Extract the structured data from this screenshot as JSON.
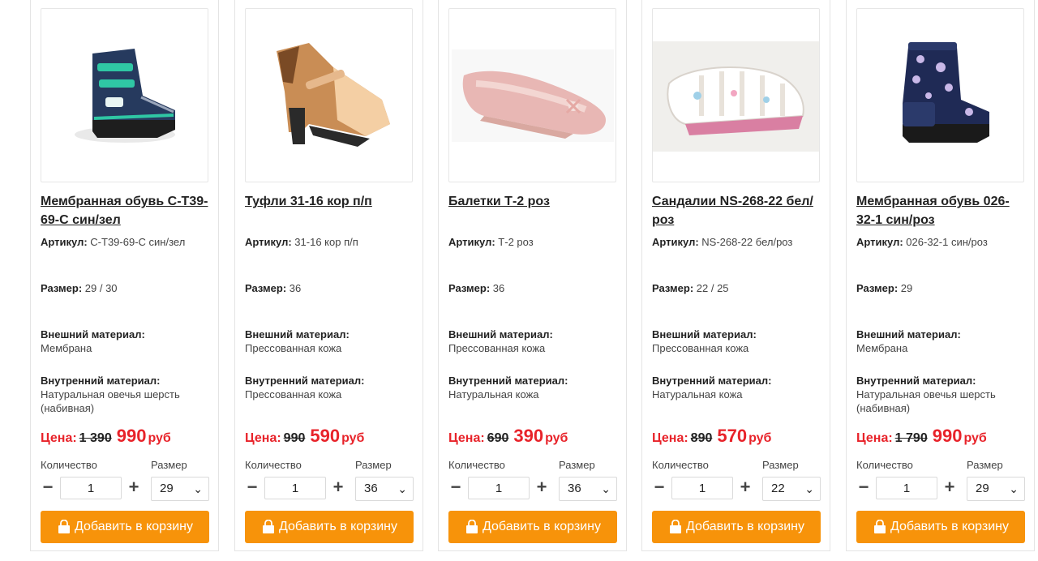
{
  "labels": {
    "article": "Артикул:",
    "size": "Размер:",
    "outer_material": "Внешний материал:",
    "inner_material": "Внутренний материал:",
    "price": "Цена:",
    "quantity": "Количество",
    "size_select": "Размер",
    "add_to_cart": "Добавить в корзину"
  },
  "products": [
    {
      "title": "Мембранная обувь С-Т39-69-С син/зел",
      "article": "С-Т39-69-С син/зел",
      "size": "29 / 30",
      "outer_material": "Мембрана",
      "inner_material": "Натуральная овечья шерсть (набивная)",
      "old_price": "1 390",
      "new_price": "990",
      "currency": "руб",
      "quantity": "1",
      "selected_size": "29",
      "image": "winter-boot-navy-green"
    },
    {
      "title": "Туфли 31-16 кор п/п",
      "article": "31-16 кор п/п",
      "size": "36",
      "outer_material": "Прессованная кожа",
      "inner_material": "Прессованная кожа",
      "old_price": "990",
      "new_price": "590",
      "currency": "руб",
      "quantity": "1",
      "selected_size": "36",
      "image": "heeled-shoe-brown-beige"
    },
    {
      "title": "Балетки Т-2 роз",
      "article": "Т-2 роз",
      "size": "36",
      "outer_material": "Прессованная кожа",
      "inner_material": "Натуральная кожа",
      "old_price": "690",
      "new_price": "390",
      "currency": "руб",
      "quantity": "1",
      "selected_size": "36",
      "image": "ballet-flat-pink"
    },
    {
      "title": "Сандалии NS-268-22 бел/роз",
      "article": "NS-268-22 бел/роз",
      "size": "22 / 25",
      "outer_material": "Прессованная кожа",
      "inner_material": "Натуральная кожа",
      "old_price": "890",
      "new_price": "570",
      "currency": "руб",
      "quantity": "1",
      "selected_size": "22",
      "image": "sandal-white-pink"
    },
    {
      "title": "Мембранная обувь 026-32-1 син/роз",
      "article": "026-32-1 син/роз",
      "size": "29",
      "outer_material": "Мембрана",
      "inner_material": "Натуральная овечья шерсть (набивная)",
      "old_price": "1 790",
      "new_price": "990",
      "currency": "руб",
      "quantity": "1",
      "selected_size": "29",
      "image": "winter-boot-navy-floral"
    }
  ],
  "colors": {
    "price_red": "#e8232a",
    "button_orange": "#f7930a"
  }
}
